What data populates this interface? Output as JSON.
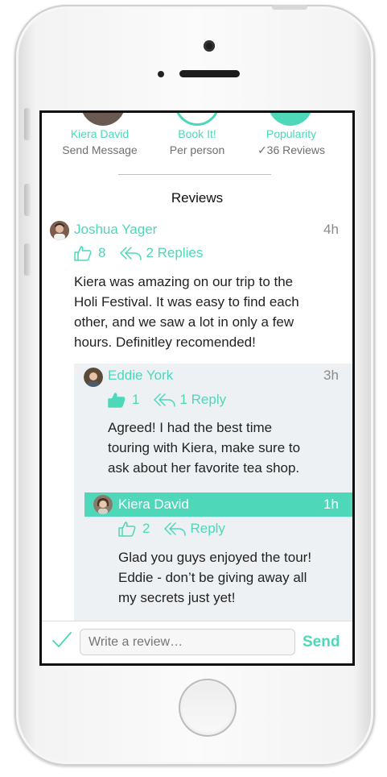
{
  "header": {
    "guide": {
      "name": "Kiera David",
      "sub": "Send Message"
    },
    "book": {
      "label": "Book It!",
      "sub": "Per person"
    },
    "popularity": {
      "label": "Popularity",
      "sub": "✓36 Reviews"
    }
  },
  "reviews_title": "Reviews",
  "reviews": [
    {
      "author": "Joshua Yager",
      "time": "4h",
      "likes": "8",
      "replies": "2 Replies",
      "text_lines": [
        "Kiera was amazing on our trip to the",
        "Holi Festival. It was easy to find each",
        "other, and we saw a lot in only a few",
        "hours. Definitley recomended!"
      ]
    }
  ],
  "replies": [
    {
      "author": "Eddie York",
      "time": "3h",
      "likes": "1",
      "replies": "1 Reply",
      "text_lines": [
        "Agreed! I had the best time",
        "touring  with Kiera, make sure to",
        "ask about her favorite tea shop."
      ]
    },
    {
      "author": "Kiera David",
      "time": "1h",
      "likes": "2",
      "replies": "Reply",
      "text_lines": [
        "Glad you guys enjoyed the tour!",
        "Eddie - don’t be giving away all",
        "my secrets just yet!"
      ]
    }
  ],
  "compose": {
    "placeholder": "Write a review…",
    "send_label": "Send"
  },
  "colors": {
    "accent": "#4ed7b8",
    "reply_bg": "#eef1f3"
  }
}
